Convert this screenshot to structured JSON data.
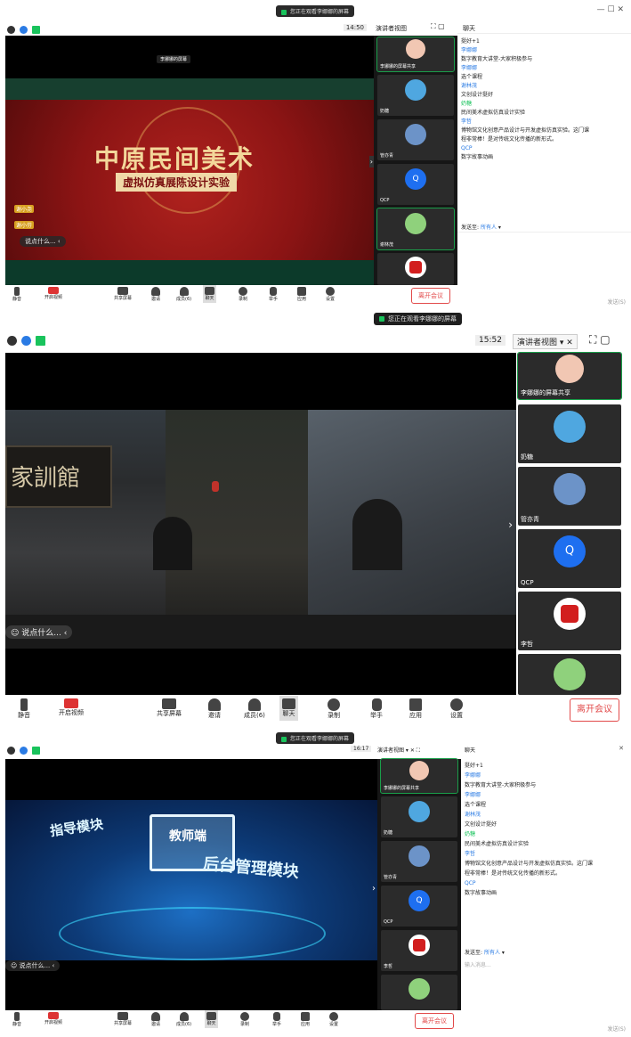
{
  "shot1": {
    "banner": "您正在观看李娜娜的屏幕",
    "time": "14:50",
    "view_label": "演讲者视图",
    "chat_title": "聊天",
    "banner_title": "中原民间美术",
    "banner_subtitle": "虚拟仿真展陈设计实验",
    "banner_top_pill": "李娜娜的屏幕",
    "speech": "说点什么...",
    "tiles": [
      {
        "name": "李娜娜的屏幕共享"
      },
      {
        "name": "奶糖"
      },
      {
        "name": "管亦青"
      },
      {
        "name": "QCP"
      },
      {
        "name": "谢林茂"
      },
      {
        "name": ""
      }
    ],
    "badges": [
      "谢小尧",
      "谢小芬"
    ],
    "chat_messages": [
      {
        "who": "",
        "text": "挺好+1"
      },
      {
        "who": "李娜娜",
        "text": "数字教育大讲堂-大家积极参与"
      },
      {
        "who": "李娜娜",
        "text": "选个课程"
      },
      {
        "who": "谢林茂",
        "text": "文创设计挺好"
      },
      {
        "who": "奶糖",
        "text": "民间美术虚拟仿真设计实验"
      },
      {
        "who": "李哲",
        "text": "博物馆文化创意产品设计与开发虚拟仿真实验。这门课"
      },
      {
        "who": "",
        "text": "程非常棒！是对传统文化传播的新形式。"
      },
      {
        "who": "QCP",
        "text": "数字故事动画"
      }
    ],
    "send_to_label": "发送至:",
    "send_to_value": "所有人",
    "send_label": "发送(S)",
    "end_label": "离开会议",
    "footer_pill": "您正在观看李娜娜的屏幕",
    "toolbar": [
      "静音",
      "开启视频",
      "共享屏幕",
      "邀请",
      "成员(6)",
      "聊天",
      "录制",
      "举手",
      "应用",
      "设置"
    ]
  },
  "shot2": {
    "time": "15:52",
    "view_label": "演讲者视图",
    "sign_text": "家訓館",
    "speech": "说点什么...",
    "tiles": [
      {
        "name": "李娜娜的屏幕共享"
      },
      {
        "name": "奶糖"
      },
      {
        "name": "管亦青"
      },
      {
        "name": "QCP"
      },
      {
        "name": "李哲"
      },
      {
        "name": ""
      }
    ],
    "avatar_letter": "Q",
    "end_label": "离开会议",
    "toolbar": [
      "静音",
      "开启视频",
      "共享屏幕",
      "邀请",
      "成员(6)",
      "聊天",
      "录制",
      "举手",
      "应用",
      "设置"
    ]
  },
  "shot3": {
    "banner": "您正在观看李娜娜的屏幕",
    "time": "16:17",
    "view_label": "演讲者视图",
    "chat_title": "聊天",
    "label_a": "指导模块",
    "label_b": "教师端",
    "label_c": "后台管理模块",
    "speech": "说点什么...",
    "tiles": [
      {
        "name": "李娜娜的屏幕共享"
      },
      {
        "name": "奶糖"
      },
      {
        "name": "管亦青"
      },
      {
        "name": "QCP"
      },
      {
        "name": "李哲"
      },
      {
        "name": ""
      }
    ],
    "chat_messages": [
      {
        "who": "",
        "text": "挺好+1"
      },
      {
        "who": "李娜娜",
        "text": "数字教育大讲堂-大家积极参与"
      },
      {
        "who": "李娜娜",
        "text": "选个课程"
      },
      {
        "who": "谢林茂",
        "text": "文创设计挺好"
      },
      {
        "who": "奶糖",
        "text": "民间美术虚拟仿真设计实验"
      },
      {
        "who": "李哲",
        "text": "博物馆文化创意产品设计与开发虚拟仿真实验。这门课"
      },
      {
        "who": "",
        "text": "程非常棒！是对传统文化传播的新形式。"
      },
      {
        "who": "QCP",
        "text": "数字故事动画"
      }
    ],
    "send_to_label": "发送至:",
    "send_to_value": "所有人",
    "input_placeholder": "输入消息...",
    "send_label": "发送(S)",
    "end_label": "离开会议",
    "toolbar": [
      "静音",
      "开启视频",
      "共享屏幕",
      "邀请",
      "成员(6)",
      "聊天",
      "录制",
      "举手",
      "应用",
      "设置"
    ]
  },
  "colors": {
    "accent_green": "#19c35c",
    "end_red": "#e24a4a",
    "chat_name": "#2a7be4",
    "banner_red": "#8b1414",
    "qcp_blue": "#1e6ff0"
  }
}
